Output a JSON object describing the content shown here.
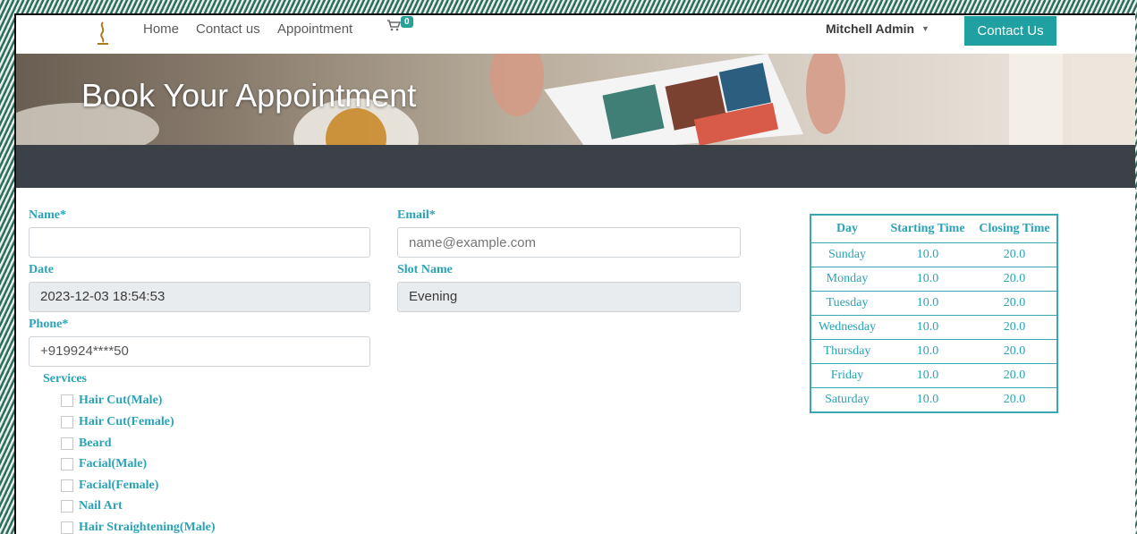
{
  "nav": {
    "links": [
      "Home",
      "Contact us",
      "Appointment"
    ],
    "cart_count": "0",
    "user": "Mitchell Admin",
    "contact_button": "Contact Us"
  },
  "hero": {
    "title": "Book Your Appointment"
  },
  "form": {
    "name_label": "Name*",
    "name_value": "",
    "email_label": "Email*",
    "email_placeholder": "name@example.com",
    "date_label": "Date",
    "date_value": "2023-12-03 18:54:53",
    "slot_label": "Slot Name",
    "slot_value": "Evening",
    "phone_label": "Phone*",
    "phone_value": "+919924****50",
    "services_label": "Services",
    "services": [
      "Hair Cut(Male)",
      "Hair Cut(Female)",
      "Beard",
      "Facial(Male)",
      "Facial(Female)",
      "Nail Art",
      "Hair Straightening(Male)"
    ]
  },
  "schedule": {
    "headers": [
      "Day",
      "Starting Time",
      "Closing Time"
    ],
    "rows": [
      [
        "Sunday",
        "10.0",
        "20.0"
      ],
      [
        "Monday",
        "10.0",
        "20.0"
      ],
      [
        "Tuesday",
        "10.0",
        "20.0"
      ],
      [
        "Wednesday",
        "10.0",
        "20.0"
      ],
      [
        "Thursday",
        "10.0",
        "20.0"
      ],
      [
        "Friday",
        "10.0",
        "20.0"
      ],
      [
        "Saturday",
        "10.0",
        "20.0"
      ]
    ]
  },
  "colors": {
    "accent": "#2aa3b6",
    "button": "#20a0a0",
    "hero_band": "#3b4147"
  },
  "icons": {
    "cart": "cart-icon",
    "logo": "logo-icon",
    "caret": "chevron-down-icon"
  }
}
